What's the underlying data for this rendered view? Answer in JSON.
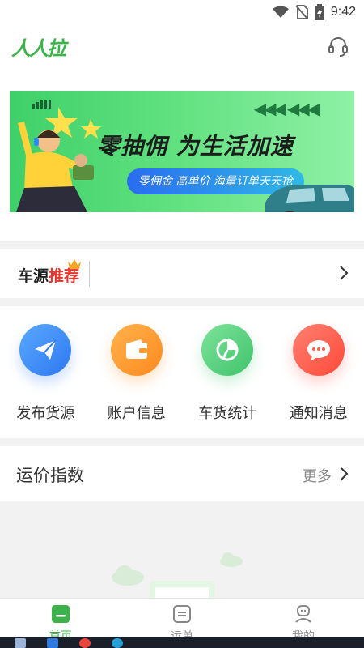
{
  "status_bar": {
    "time": "9:42"
  },
  "header": {
    "logo_text": "人人拉",
    "support_icon": "headset-icon"
  },
  "banner": {
    "title": "零抽佣 为生活加速",
    "subtitle": "零佣金 高单价 海量订单天天抢"
  },
  "recommend": {
    "title_black": "车源",
    "title_red": "推荐"
  },
  "grid": [
    {
      "label": "发布货源",
      "icon": "paper-plane-icon",
      "color": "#3a8ef6"
    },
    {
      "label": "账户信息",
      "icon": "wallet-icon",
      "color": "#ff9a2e"
    },
    {
      "label": "车货统计",
      "icon": "pie-chart-icon",
      "color": "#4fcf7b"
    },
    {
      "label": "通知消息",
      "icon": "chat-bubble-icon",
      "color": "#ff5e4d"
    }
  ],
  "freight_index": {
    "title": "运价指数",
    "more_label": "更多"
  },
  "tabs": [
    {
      "label": "首页",
      "icon": "home-icon",
      "active": true
    },
    {
      "label": "运单",
      "icon": "waybill-icon",
      "active": false
    },
    {
      "label": "我的",
      "icon": "profile-icon",
      "active": false
    }
  ],
  "colors": {
    "brand_green": "#3cb34a",
    "accent_red": "#e8352d"
  }
}
